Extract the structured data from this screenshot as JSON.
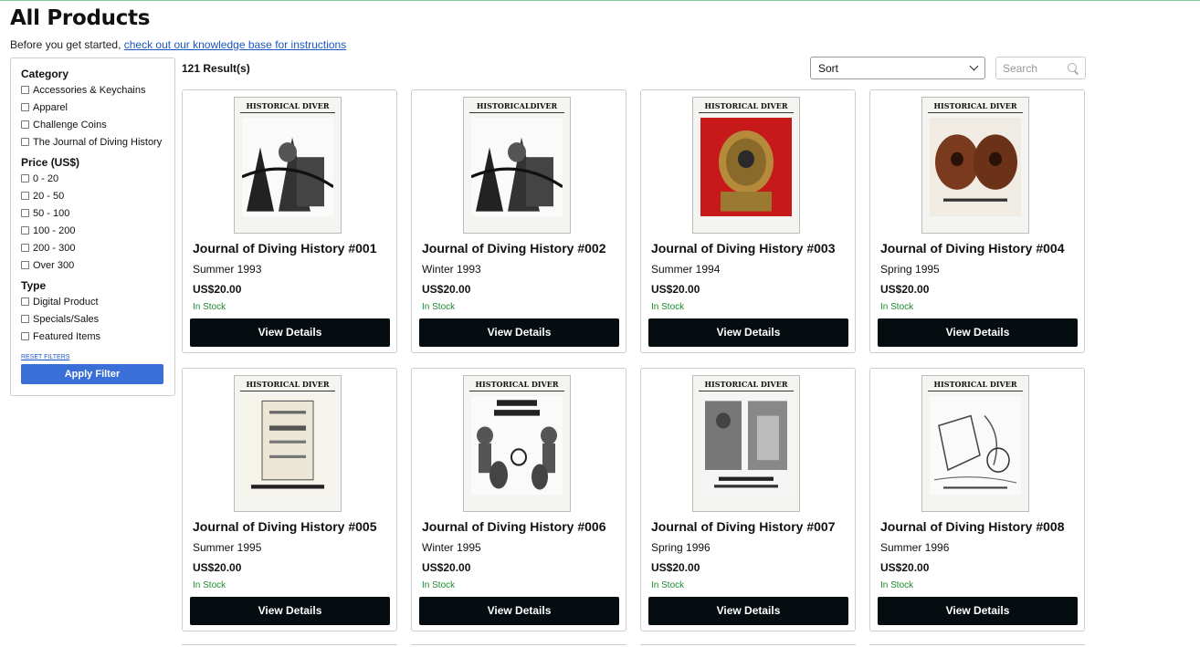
{
  "page": {
    "title": "All Products",
    "intro_text": "Before you get started,",
    "intro_link": "check out our knowledge base for instructions"
  },
  "filters": {
    "category_heading": "Category",
    "category": [
      "Accessories & Keychains",
      "Apparel",
      "Challenge Coins",
      "The Journal of Diving History"
    ],
    "price_heading": "Price  (US$)",
    "price": [
      "0 - 20",
      "20 - 50",
      "50 - 100",
      "100 - 200",
      "200 - 300",
      "Over 300"
    ],
    "type_heading": "Type",
    "type": [
      "Digital Product",
      "Specials/Sales",
      "Featured Items"
    ],
    "reset_label": "RESET FILTERS",
    "apply_label": "Apply Filter"
  },
  "toolbar": {
    "results": "121 Result(s)",
    "sort_label": "Sort",
    "search_placeholder": "Search"
  },
  "products": [
    {
      "title": "Journal of Diving History #001",
      "issue": "Summer 1993",
      "price": "US$20.00",
      "stock": "In Stock",
      "button": "View Details",
      "cover_head": "HISTORICAL DIVER",
      "cover_style": "dark"
    },
    {
      "title": "Journal of Diving History #002",
      "issue": "Winter 1993",
      "price": "US$20.00",
      "stock": "In Stock",
      "button": "View Details",
      "cover_head": "HISTORICALDIVER",
      "cover_style": "dark"
    },
    {
      "title": "Journal of Diving History #003",
      "issue": "Summer 1994",
      "price": "US$20.00",
      "stock": "In Stock",
      "button": "View Details",
      "cover_head": "HISTORICAL DIVER",
      "cover_style": "helmet"
    },
    {
      "title": "Journal of Diving History #004",
      "issue": "Spring 1995",
      "price": "US$20.00",
      "stock": "In Stock",
      "button": "View Details",
      "cover_head": "HISTORICAL DIVER",
      "cover_style": "bronze"
    },
    {
      "title": "Journal of Diving History #005",
      "issue": "Summer 1995",
      "price": "US$20.00",
      "stock": "In Stock",
      "button": "View Details",
      "cover_head": "HISTORICAL DIVER",
      "cover_style": "manual"
    },
    {
      "title": "Journal of Diving History #006",
      "issue": "Winter 1995",
      "price": "US$20.00",
      "stock": "In Stock",
      "button": "View Details",
      "cover_head": "HISTORICAL DIVER",
      "cover_style": "deep"
    },
    {
      "title": "Journal of Diving History #007",
      "issue": "Spring 1996",
      "price": "US$20.00",
      "stock": "In Stock",
      "button": "View Details",
      "cover_head": "HISTORICAL DIVER",
      "cover_style": "photo"
    },
    {
      "title": "Journal of Diving History #008",
      "issue": "Summer 1996",
      "price": "US$20.00",
      "stock": "In Stock",
      "button": "View Details",
      "cover_head": "HISTORICAL DIVER",
      "cover_style": "sketch"
    }
  ],
  "colors": {
    "accent": "#3a6fd8",
    "button": "#050d10",
    "stock": "#1e8a2e",
    "link": "#1a56c4"
  }
}
